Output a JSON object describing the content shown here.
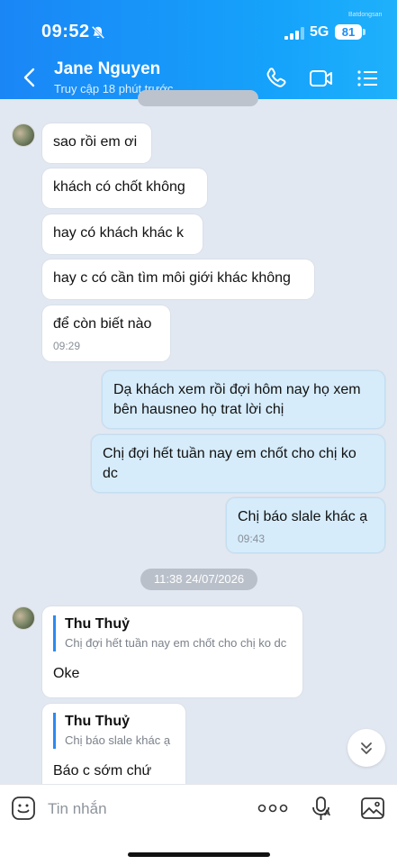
{
  "status": {
    "time": "09:52",
    "network": "5G",
    "battery": "81"
  },
  "watermark": "Batdongsan",
  "header": {
    "name": "Jane Nguyen",
    "subtitle": "Truy cập 18 phút trước"
  },
  "messages_top": [
    {
      "text": "sao rồi em ơi"
    },
    {
      "text": "khách có chốt không"
    },
    {
      "text": "hay có khách khác k"
    },
    {
      "text": "hay c có cần tìm môi giới khác không"
    },
    {
      "text": "để còn biết nào",
      "time": "09:29"
    }
  ],
  "messages_me": [
    {
      "text": "Dạ khách xem rồi đợi hôm nay họ xem bên hausneo họ trat lời chị"
    },
    {
      "text": "Chị đợi hết tuần nay em chốt cho chị ko dc"
    },
    {
      "text": "Chị báo slale khác ạ",
      "time": "09:43"
    }
  ],
  "date_separator": "11:38 24/07/2026",
  "replies": [
    {
      "quote_name": "Thu Thuỷ",
      "quote_text": "Chị đợi hết tuần nay em chốt cho chị ko dc",
      "text": "Oke"
    },
    {
      "quote_name": "Thu Thuỷ",
      "quote_text": "Chị báo slale khác ạ",
      "text": "Báo c sớm chứ"
    }
  ],
  "composer": {
    "placeholder": "Tin nhắn"
  },
  "colors": {
    "header_start": "#1a86f6",
    "header_end": "#1fb1fb",
    "my_bubble": "#d6ecfb",
    "chat_bg": "#e2e8f1"
  }
}
